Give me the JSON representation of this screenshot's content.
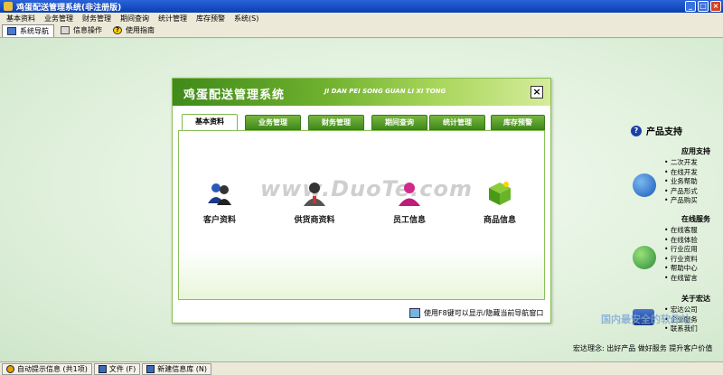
{
  "window": {
    "title": "鸡蛋配送管理系统(非注册版)",
    "controls": [
      "_",
      "□",
      "×"
    ]
  },
  "menu": [
    "基本资料",
    "业务管理",
    "财务管理",
    "期间查询",
    "统计管理",
    "库存预警",
    "系统(S)"
  ],
  "nav_tabs": [
    {
      "label": "系统导航",
      "icon": "nav-icon",
      "active": true
    },
    {
      "label": "信息操作",
      "icon": "info-icon",
      "active": false
    },
    {
      "label": "使用指南",
      "icon": "help-icon",
      "active": false
    }
  ],
  "dialog": {
    "title": "鸡蛋配送管理系统",
    "subtitle": "JI DAN PEI SONG GUAN LI XI TONG",
    "close": "×",
    "tabs": [
      "基本资料",
      "业务管理",
      "财务管理",
      "期间查询",
      "统计管理",
      "库存预警"
    ],
    "active_tab": 0,
    "items": [
      {
        "label": "客户资料",
        "icon": "customer-icon"
      },
      {
        "label": "供货商资料",
        "icon": "supplier-icon"
      },
      {
        "label": "员工信息",
        "icon": "employee-icon"
      },
      {
        "label": "商品信息",
        "icon": "product-icon"
      }
    ],
    "watermark": "www.DuoTe.com",
    "footer": "使用F8键可以显示/隐藏当前导航窗口"
  },
  "right_panel": {
    "title": "产品支持",
    "sections": [
      {
        "heading": "应用支持",
        "links": [
          "二次开发",
          "在线开发",
          "业务帮助",
          "产品形式",
          "产品购买"
        ]
      },
      {
        "heading": "在线服务",
        "links": [
          "在线客服",
          "在线体验",
          "行业应用",
          "行业资料",
          "帮助中心",
          "在线留言"
        ]
      },
      {
        "heading": "关于宏达",
        "links": [
          "宏达公司",
          "企业服务",
          "联系我们"
        ]
      }
    ],
    "slogan": "宏达理念: 出好产品 做好服务 提升客户价值",
    "site_watermark": "国内最安全的软件站"
  },
  "taskbar": [
    "自动提示信息 (共1项)",
    "文件 (F)",
    "新建信息库 (N)"
  ]
}
